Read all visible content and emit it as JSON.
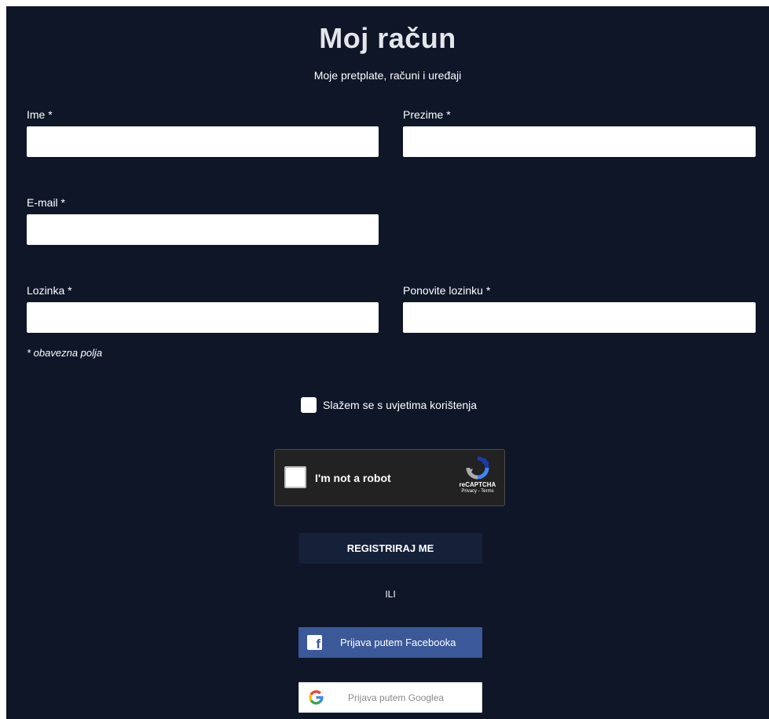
{
  "header": {
    "title": "Moj račun",
    "subtitle": "Moje pretplate, računi i uređaji"
  },
  "form": {
    "first_name_label": "Ime *",
    "last_name_label": "Prezime *",
    "email_label": "E-mail *",
    "password_label": "Lozinka *",
    "repeat_password_label": "Ponovite lozinku *",
    "first_name_value": "",
    "last_name_value": "",
    "email_value": "",
    "password_value": "",
    "repeat_password_value": "",
    "required_note": "* obavezna polja",
    "agree_label": "Slažem se s  uvjetima korištenja",
    "agree_checked": false
  },
  "recaptcha": {
    "label": "I'm not a robot",
    "brand": "reCAPTCHA",
    "links": "Privacy - Terms"
  },
  "actions": {
    "register_label": "REGISTRIRAJ ME",
    "or_label": "ILI",
    "facebook_label": "Prijava putem Facebooka",
    "google_label": "Prijava putem Googlea"
  },
  "colors": {
    "background": "#0e1628",
    "register_button": "#152039",
    "facebook": "#3b5998"
  },
  "icons": [
    "facebook-icon",
    "google-icon",
    "recaptcha-icon"
  ]
}
